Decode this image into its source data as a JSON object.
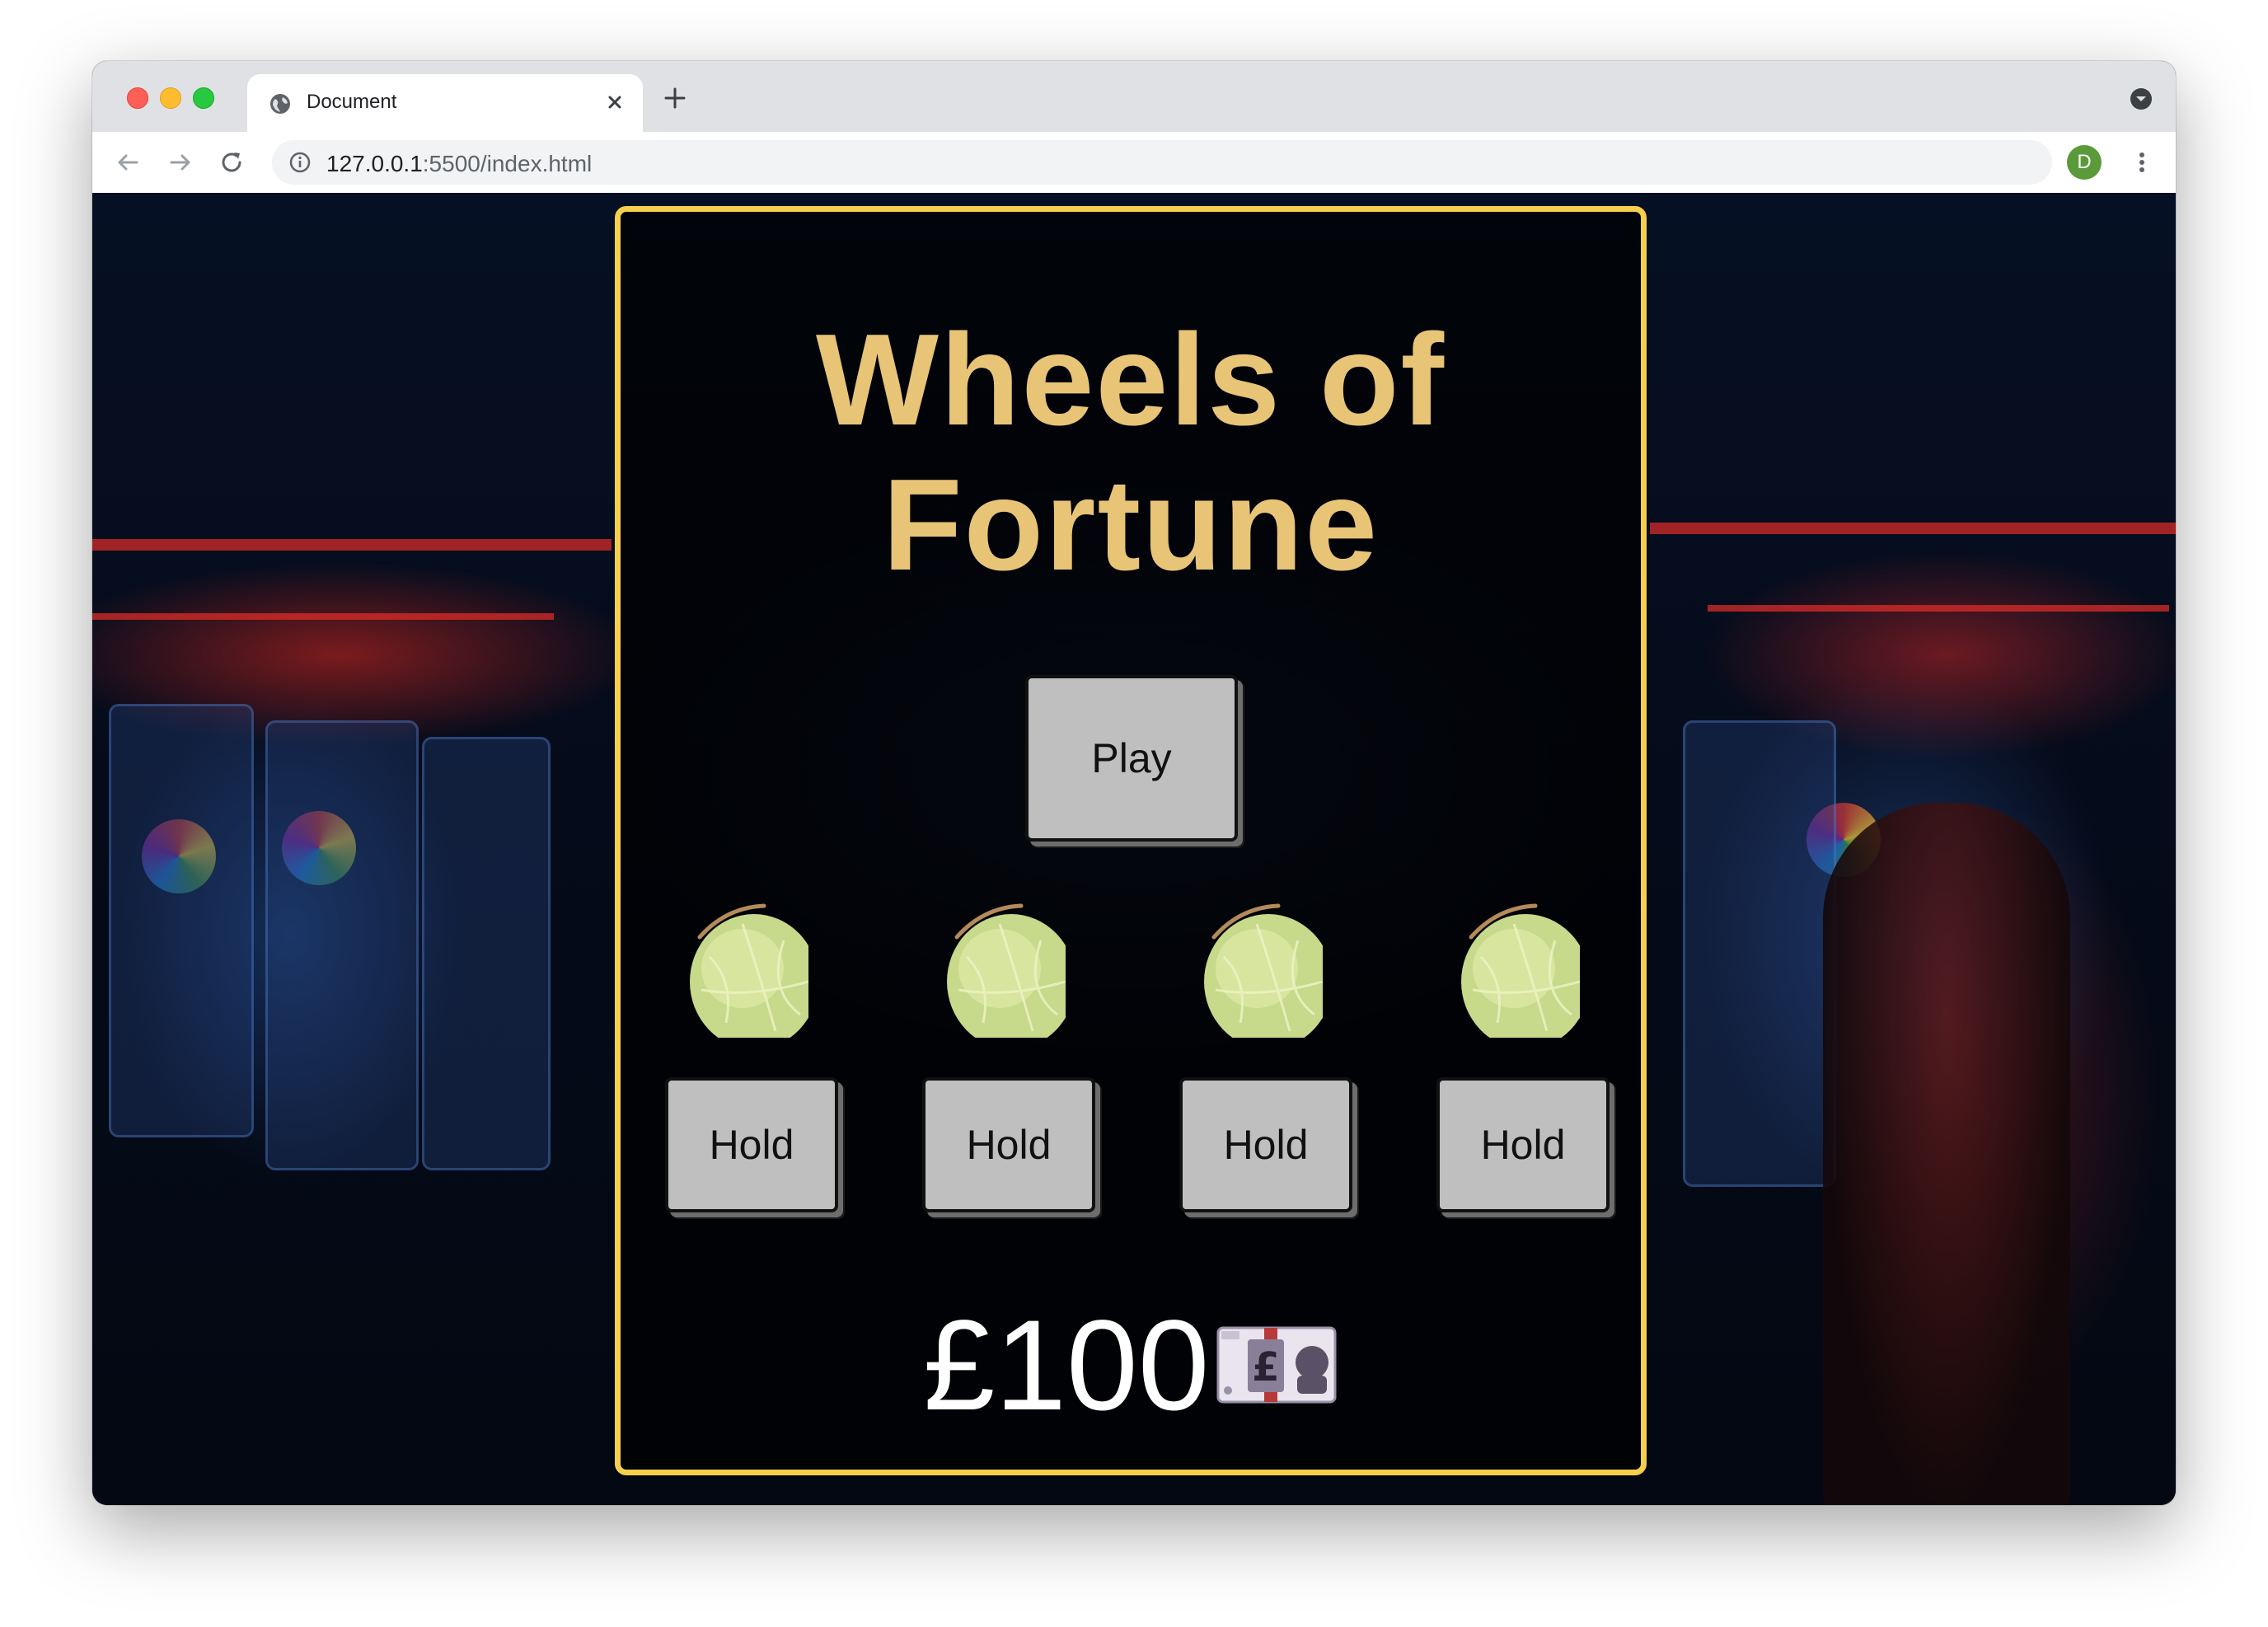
{
  "browser": {
    "tab_title": "Document",
    "url_host": "127.0.0.1",
    "url_rest": ":5500/index.html",
    "profile_initial": "D"
  },
  "game": {
    "title_line1": "Wheels of",
    "title_line2": "Fortune",
    "play_label": "Play",
    "reels": [
      {
        "icon": "melon-icon"
      },
      {
        "icon": "melon-icon"
      },
      {
        "icon": "melon-icon"
      },
      {
        "icon": "melon-icon"
      }
    ],
    "hold_labels": [
      "Hold",
      "Hold",
      "Hold",
      "Hold"
    ],
    "balance": "£100",
    "balance_icon": "pound-banknote-icon"
  },
  "colors": {
    "panel_border": "#f6d04d",
    "title": "#e8c477",
    "button_bg": "#bfbfbf"
  }
}
